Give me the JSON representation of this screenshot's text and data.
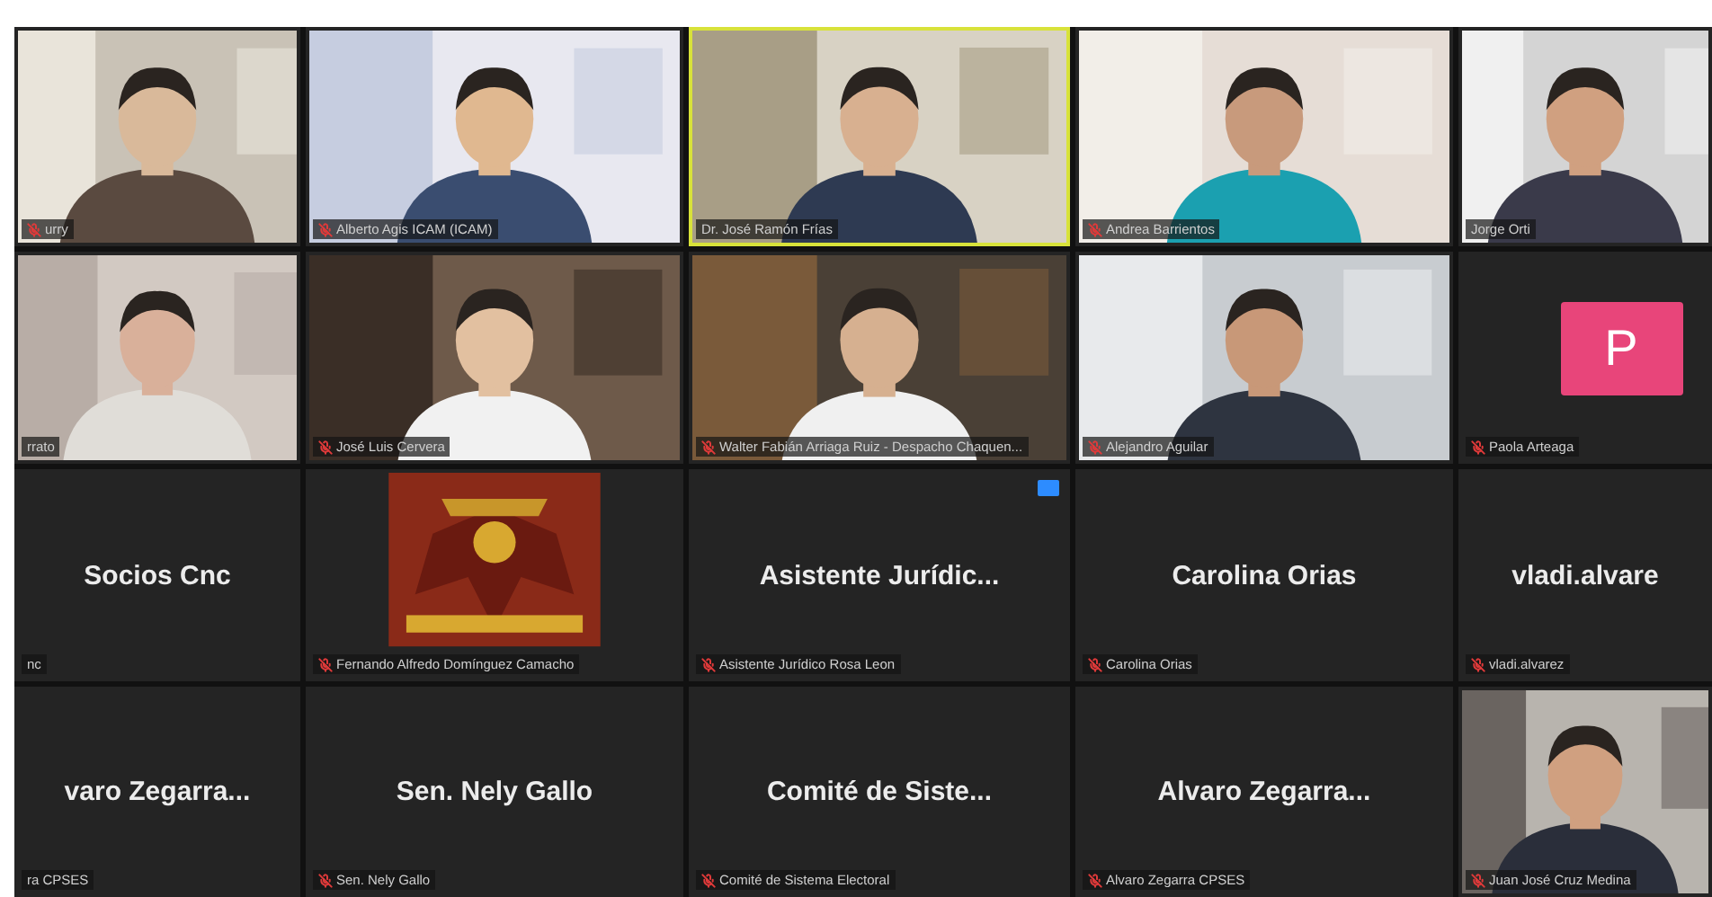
{
  "gallery": {
    "rows": [
      {
        "tiles": [
          {
            "kind": "video",
            "label": "urry",
            "muted": true,
            "speaking": false,
            "reaction": false
          },
          {
            "kind": "video",
            "label": "Alberto Agis ICAM (ICAM)",
            "muted": true,
            "speaking": false,
            "reaction": false
          },
          {
            "kind": "video",
            "label": "Dr. José Ramón Frías",
            "muted": false,
            "speaking": true,
            "reaction": false
          },
          {
            "kind": "video",
            "label": "Andrea Barrientos",
            "muted": true,
            "speaking": false,
            "reaction": false
          },
          {
            "kind": "video",
            "label": "Jorge Orti",
            "muted": false,
            "speaking": false,
            "reaction": false
          }
        ]
      },
      {
        "tiles": [
          {
            "kind": "video",
            "label": "rrato",
            "muted": false,
            "speaking": false,
            "reaction": false
          },
          {
            "kind": "video",
            "label": "José Luis Cervera",
            "muted": true,
            "speaking": false,
            "reaction": false
          },
          {
            "kind": "video",
            "label": "Walter Fabián Arriaga Ruiz - Despacho Chaquen...",
            "muted": true,
            "speaking": false,
            "reaction": false
          },
          {
            "kind": "video",
            "label": "Alejandro Aguilar",
            "muted": true,
            "speaking": false,
            "reaction": false
          },
          {
            "kind": "avatar",
            "initial": "P",
            "label": "Paola Arteaga",
            "muted": true,
            "speaking": false,
            "reaction": false
          }
        ]
      },
      {
        "tiles": [
          {
            "kind": "name",
            "name": "Socios Cnc",
            "label": "nc",
            "muted": false,
            "speaking": false,
            "reaction": false
          },
          {
            "kind": "video",
            "label": "Fernando Alfredo Domínguez Camacho",
            "muted": true,
            "speaking": false,
            "reaction": false
          },
          {
            "kind": "name",
            "name": "Asistente  Jurídic...",
            "label": "Asistente Jurídico Rosa Leon",
            "muted": true,
            "speaking": false,
            "reaction": true
          },
          {
            "kind": "name",
            "name": "Carolina Orias",
            "label": "Carolina Orias",
            "muted": true,
            "speaking": false,
            "reaction": false
          },
          {
            "kind": "name",
            "name": "vladi.alvare",
            "label": "vladi.alvarez",
            "muted": true,
            "speaking": false,
            "reaction": false
          }
        ]
      },
      {
        "tiles": [
          {
            "kind": "name",
            "name": "varo  Zegarra...",
            "label": "ra CPSES",
            "muted": false,
            "speaking": false,
            "reaction": false
          },
          {
            "kind": "name",
            "name": "Sen. Nely Gallo",
            "label": "Sen. Nely Gallo",
            "muted": true,
            "speaking": false,
            "reaction": false
          },
          {
            "kind": "name",
            "name": "Comité  de Siste...",
            "label": "Comité de Sistema Electoral",
            "muted": true,
            "speaking": false,
            "reaction": false
          },
          {
            "kind": "name",
            "name": "Alvaro  Zegarra...",
            "label": "Alvaro Zegarra CPSES",
            "muted": true,
            "speaking": false,
            "reaction": false
          },
          {
            "kind": "video",
            "label": "Juan José Cruz Medina",
            "muted": true,
            "speaking": false,
            "reaction": false
          }
        ]
      }
    ]
  }
}
